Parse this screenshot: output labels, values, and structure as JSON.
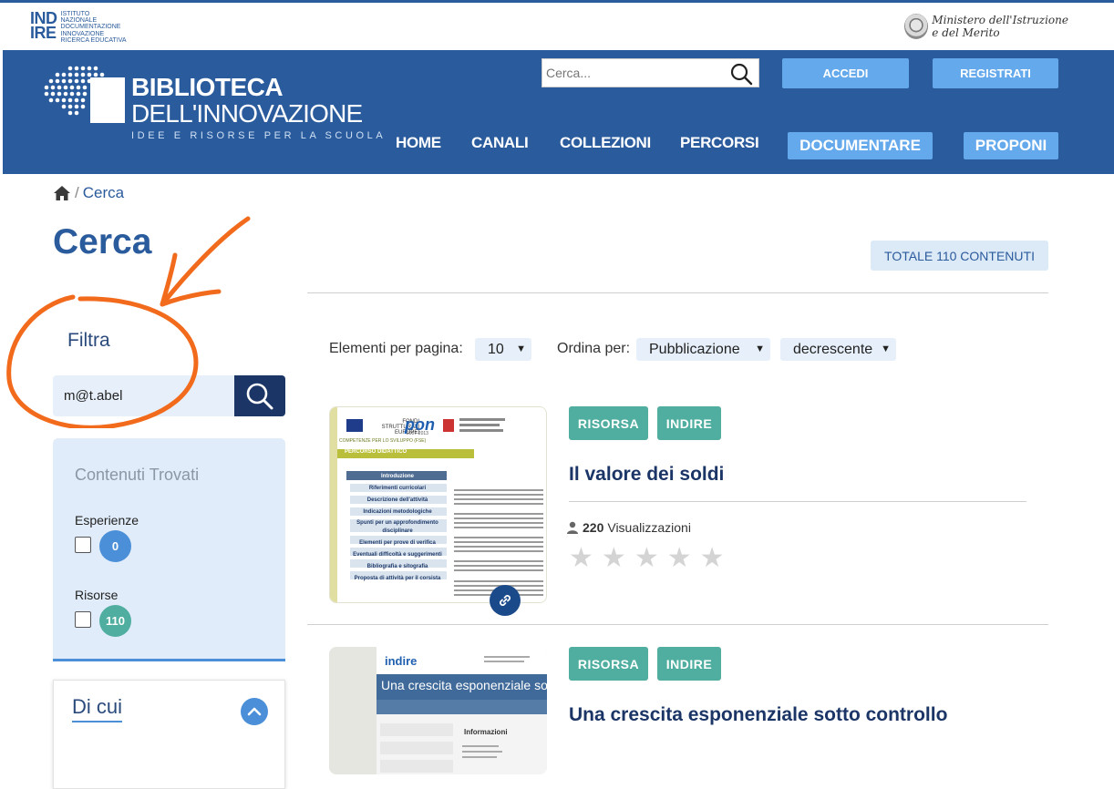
{
  "topbar": {
    "indire_mark_line1": "IND",
    "indire_mark_line2": "IRE",
    "indire_text": [
      "ISTITUTO",
      "NAZIONALE",
      "DOCUMENTAZIONE",
      "INNOVAZIONE",
      "RICERCA EDUCATIVA"
    ],
    "ministero_line1": "Ministero dell'Istruzione",
    "ministero_line2": "e del Merito"
  },
  "header": {
    "logo_title": "BIBLIOTECA",
    "logo_title2": "DELL'INNOVAZIONE",
    "logo_sub": "IDEE E RISORSE PER LA SCUOLA",
    "search_placeholder": "Cerca...",
    "accedi": "ACCEDI",
    "registrati": "REGISTRATI",
    "nav": {
      "home": "HOME",
      "canali": "CANALI",
      "collezioni": "COLLEZIONI",
      "percorsi": "PERCORSI",
      "documentare": "DOCUMENTARE",
      "proponi": "PROPONI"
    }
  },
  "breadcrumb": {
    "sep": "/",
    "current": "Cerca"
  },
  "page": {
    "title": "Cerca",
    "total": "TOTALE 110 CONTENUTI"
  },
  "filter": {
    "title": "Filtra",
    "query": "m@t.abel",
    "found_title": "Contenuti Trovati",
    "groups": [
      {
        "label": "Esperienze",
        "count": "0",
        "color": "#4a8fd8"
      },
      {
        "label": "Risorse",
        "count": "110",
        "color": "#4fae9f"
      }
    ],
    "dicui": "Di cui"
  },
  "controls": {
    "per_page_label": "Elementi per pagina:",
    "per_page_value": "10",
    "sort_label": "Ordina per:",
    "sort_value": "Pubblicazione",
    "order_value": "decrescente"
  },
  "results": [
    {
      "tags": [
        "RISORSA",
        "INDIRE"
      ],
      "title": "Il valore dei soldi",
      "views_count": "220",
      "views_label": "Visualizzazioni",
      "rating": 0,
      "thumb": {
        "header_text": [
          "FONDI",
          "STRUTTURALI",
          "EUROPEI"
        ],
        "pon": "pon",
        "pon_sub": "2007-2013",
        "competenze": "COMPETENZE PER LO SVILUPPO (FSE)",
        "section": "PERCORSO DIDATTICO",
        "menu": [
          "Introduzione",
          "Riferimenti curricolari",
          "Descrizione dell'attività",
          "Indicazioni metodologiche",
          "Spunti per un approfondimento disciplinare",
          "Elementi per prove di verifica",
          "Eventuali difficoltà e suggerimenti",
          "Bibliografia e sitografia",
          "Proposta di attività per il corsista"
        ]
      }
    },
    {
      "tags": [
        "RISORSA",
        "INDIRE"
      ],
      "title": "Una crescita esponenziale sotto controllo",
      "thumb": {
        "brand": "indire",
        "banner": "Una crescita esponenziale sotto contro",
        "section": "Informazioni"
      }
    }
  ]
}
